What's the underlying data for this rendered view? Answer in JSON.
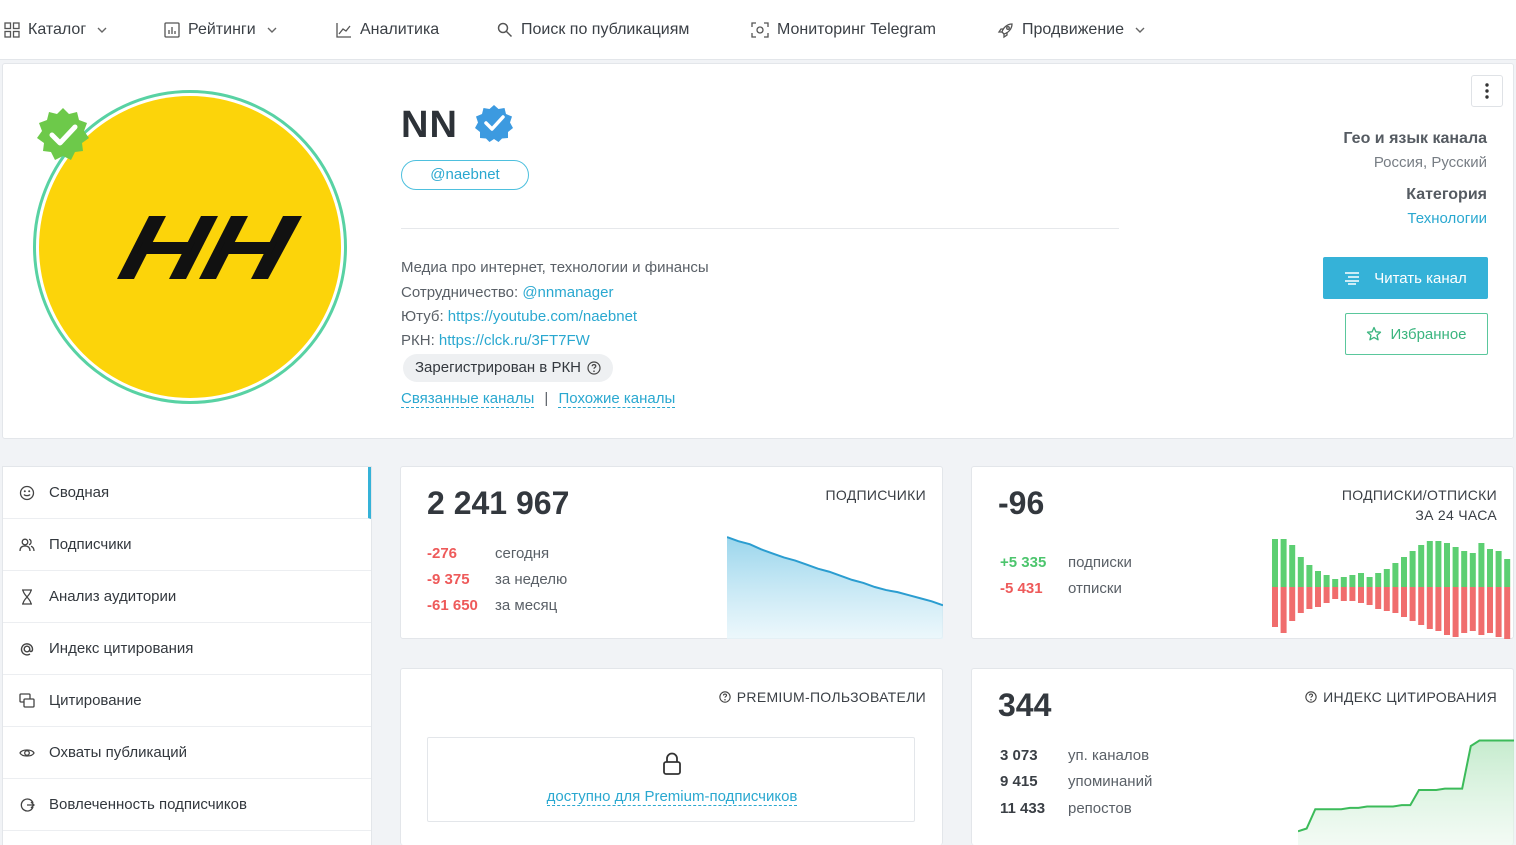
{
  "nav": {
    "items": [
      {
        "label": "Каталог",
        "icon": "grid-icon",
        "dropdown": true
      },
      {
        "label": "Рейтинги",
        "icon": "chart-box-icon",
        "dropdown": true
      },
      {
        "label": "Аналитика",
        "icon": "line-chart-icon",
        "dropdown": false
      },
      {
        "label": "Поиск по публикациям",
        "icon": "search-icon",
        "dropdown": false
      },
      {
        "label": "Мониторинг Telegram",
        "icon": "scan-icon",
        "dropdown": false
      },
      {
        "label": "Продвижение",
        "icon": "rocket-icon",
        "dropdown": true
      }
    ]
  },
  "channel": {
    "name": "NN",
    "avatar_text": "HH",
    "handle": "@naebnet",
    "description": "Медиа про интернет, технологии и финансы",
    "coop_label": "Сотрудничество:",
    "coop_link": "@nnmanager",
    "youtube_label": "Ютуб:",
    "youtube_link": "https://youtube.com/naebnet",
    "rkn_label": "РКН:",
    "rkn_link": "https://clck.ru/3FT7FW",
    "rkn_badge": "Зарегистрирован в РКН",
    "related": "Связанные каналы",
    "separator": "|",
    "similar": "Похожие каналы",
    "geo_heading": "Гео и язык канала",
    "geo_value": "Россия, Русский",
    "category_heading": "Категория",
    "category_value": "Технологии",
    "read_button": "Читать канал",
    "fav_button": "Избранное"
  },
  "sidebar": {
    "items": [
      {
        "label": "Сводная",
        "icon": "summary-icon"
      },
      {
        "label": "Подписчики",
        "icon": "users-icon"
      },
      {
        "label": "Анализ аудитории",
        "icon": "hourglass-icon"
      },
      {
        "label": "Индекс цитирования",
        "icon": "at-icon"
      },
      {
        "label": "Цитирование",
        "icon": "quote-icon"
      },
      {
        "label": "Охваты публикаций",
        "icon": "eye-icon"
      },
      {
        "label": "Вовлеченность подписчиков",
        "icon": "engagement-icon"
      }
    ]
  },
  "subscribers": {
    "label": "ПОДПИСЧИКИ",
    "total": "2 241 967",
    "rows": [
      {
        "value": "-276",
        "text": "сегодня"
      },
      {
        "value": "-9 375",
        "text": "за неделю"
      },
      {
        "value": "-61 650",
        "text": "за месяц"
      }
    ]
  },
  "daily": {
    "label_line1": "ПОДПИСКИ/ОТПИСКИ",
    "label_line2": "ЗА 24 ЧАСА",
    "total": "-96",
    "rows": [
      {
        "value": "+5 335",
        "text": "подписки"
      },
      {
        "value": "-5 431",
        "text": "отписки"
      }
    ]
  },
  "premium": {
    "label": "PREMIUM-ПОЛЬЗОВАТЕЛИ",
    "locked_text": "доступно для Premium-подписчиков"
  },
  "citation": {
    "label": "ИНДЕКС ЦИТИРОВАНИЯ",
    "total": "344",
    "rows": [
      {
        "value": "3 073",
        "text": "уп. каналов"
      },
      {
        "value": "9 415",
        "text": "упоминаний"
      },
      {
        "value": "11 433",
        "text": "репостов"
      }
    ]
  },
  "colors": {
    "accent": "#35b2d8",
    "green": "#4cc56d",
    "red": "#ee5a5a",
    "avatar_bg": "#fcd40a"
  },
  "chart_data": [
    {
      "type": "area",
      "series": [
        {
          "values": [
            100,
            96,
            93,
            88,
            84,
            80,
            77,
            73,
            69,
            66,
            62,
            58,
            55,
            51,
            48,
            46,
            43,
            40,
            37,
            33
          ]
        }
      ]
    },
    {
      "type": "bar",
      "series": [
        {
          "values": [
            48,
            50,
            42,
            30,
            22,
            16,
            12,
            8,
            10,
            12,
            14,
            10,
            14,
            18,
            24,
            30,
            36,
            42,
            46,
            46,
            44,
            40,
            36,
            34,
            44,
            38,
            36,
            28
          ]
        },
        {
          "values": [
            -40,
            -46,
            -34,
            -26,
            -22,
            -20,
            -16,
            -12,
            -14,
            -14,
            -16,
            -18,
            -22,
            -24,
            -26,
            -30,
            -34,
            -38,
            -42,
            -44,
            -48,
            -50,
            -46,
            -44,
            -48,
            -46,
            -50,
            -52
          ]
        }
      ]
    },
    {
      "type": "line",
      "series": [
        {
          "values": [
            10,
            12,
            26,
            26,
            26,
            26,
            27,
            27,
            28,
            28,
            28,
            28,
            29,
            29,
            40,
            40,
            40,
            41,
            41,
            41,
            72,
            76,
            76,
            76,
            76,
            76
          ]
        }
      ]
    }
  ]
}
